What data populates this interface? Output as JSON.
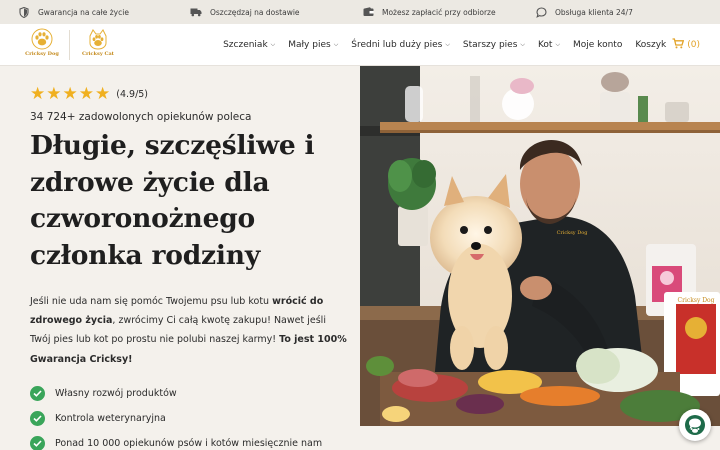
{
  "topbar": {
    "items": [
      {
        "icon": "shield-icon",
        "label": "Gwarancja na całe życie"
      },
      {
        "icon": "truck-icon",
        "label": "Oszczędzaj na dostawie"
      },
      {
        "icon": "wallet-icon",
        "label": "Możesz zapłacić przy odbiorze"
      },
      {
        "icon": "chat-bubble-icon",
        "label": "Obsługa klienta 24/7"
      }
    ]
  },
  "header": {
    "logos": [
      {
        "name": "Cricksy Dog",
        "text": "Cricksy Dog"
      },
      {
        "name": "Cricksy Cat",
        "text": "Cricksy Cat"
      }
    ],
    "nav": [
      {
        "label": "Szczeniak",
        "dropdown": true
      },
      {
        "label": "Mały pies",
        "dropdown": true
      },
      {
        "label": "Średni lub duży pies",
        "dropdown": true
      },
      {
        "label": "Starszy pies",
        "dropdown": true
      },
      {
        "label": "Kot",
        "dropdown": true
      },
      {
        "label": "Moje konto",
        "dropdown": false
      }
    ],
    "cart": {
      "label": "Koszyk",
      "count": "(0)"
    },
    "colors": {
      "accent": "#e2a329"
    }
  },
  "hero": {
    "rating": {
      "stars": 5,
      "value": "(4.9/5)"
    },
    "reviews": "34 724+ zadowolonych opiekunów poleca",
    "title": "Długie, szczęśliwe i zdrowe życie dla czworonożnego członka rodziny",
    "description": {
      "part1": "Jeśli nie uda nam się pomóc Twojemu psu lub kotu ",
      "bold1": "wrócić do zdrowego życia",
      "part2": ", zwrócimy Ci całą kwotę zakupu! Nawet jeśli Twój pies lub kot po prostu nie polubi naszej karmy! ",
      "bold2": "To jest 100% Gwarancja Cricksy!"
    },
    "features": [
      "Własny rozwój produktów",
      "Kontrola weterynaryjna",
      "Ponad 10 000 opiekunów psów i kotów miesięcznie nam"
    ],
    "check_color": "#3aa55a",
    "photo_product_label": "Cricksy Dog"
  }
}
